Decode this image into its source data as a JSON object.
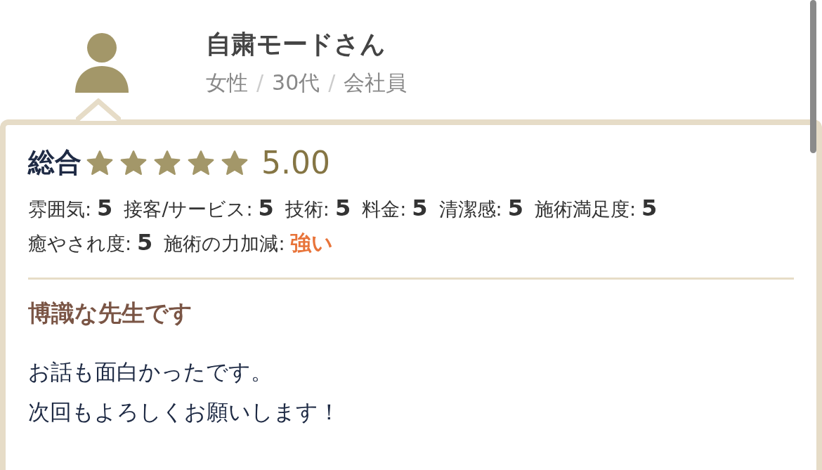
{
  "reviewer": {
    "name": "自粛モードさん",
    "attributes": [
      "女性",
      "30代",
      "会社員"
    ],
    "separators": [
      "/",
      "/"
    ]
  },
  "overall": {
    "label": "総合",
    "stars": 5,
    "score": "5.00"
  },
  "ratings": [
    {
      "label": "雰囲気:",
      "value": "5",
      "kind": "score"
    },
    {
      "label": "接客/サービス:",
      "value": "5",
      "kind": "score"
    },
    {
      "label": "技術:",
      "value": "5",
      "kind": "score"
    },
    {
      "label": "料金:",
      "value": "5",
      "kind": "score"
    },
    {
      "label": "清潔感:",
      "value": "5",
      "kind": "score"
    },
    {
      "label": "施術満足度:",
      "value": "5",
      "kind": "score"
    },
    {
      "label": "癒やされ度:",
      "value": "5",
      "kind": "score"
    },
    {
      "label": "施術の力加減:",
      "value": "強い",
      "kind": "strength"
    }
  ],
  "review": {
    "title": "博識な先生です",
    "body_lines": [
      "お話も面白かったです。",
      "次回もよろしくお願いします！"
    ]
  }
}
